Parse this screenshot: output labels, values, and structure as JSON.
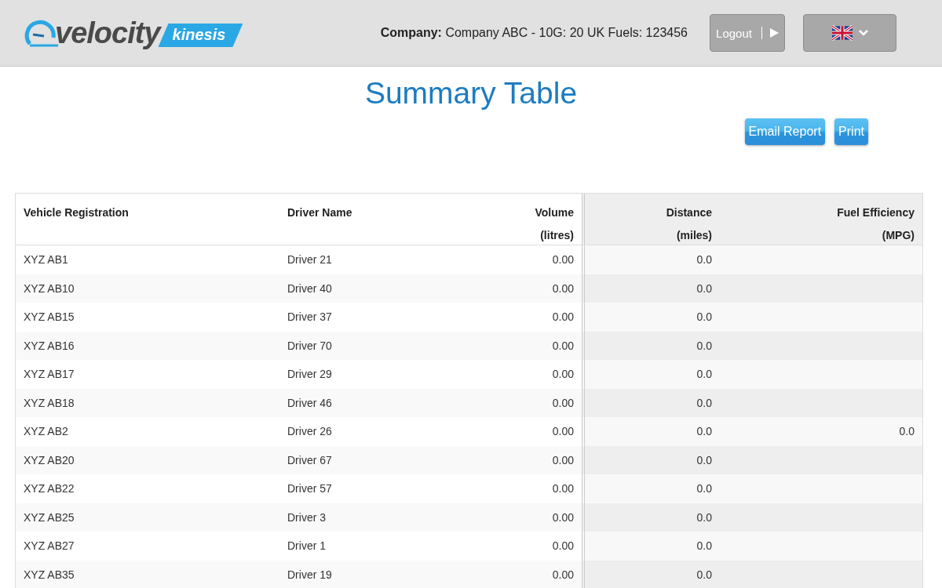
{
  "header": {
    "logo": {
      "word": "velocity",
      "badge": "kinesis"
    },
    "company": "**Company:** Company ABC - 10G: 20 UK Fuels: 123456",
    "logout": "Logout"
  },
  "title": "Summary Table",
  "actions": [
    "Email Report",
    "Print"
  ],
  "table": {
    "columns": [
      {
        "label": "Vehicle Registration",
        "kind": "text",
        "shaded": false
      },
      {
        "label": "Driver Name",
        "kind": "text",
        "shaded": false
      },
      {
        "label": "Volume",
        "unit": "(litres)",
        "kind": "number",
        "shaded": false
      },
      {
        "label": "Distance",
        "unit": "(miles)",
        "kind": "number",
        "shaded": true
      },
      {
        "label": "Fuel Efficiency",
        "unit": "(MPG)",
        "kind": "number",
        "shaded": true
      }
    ],
    "rows": [
      [
        "XYZ AB1",
        "Driver 21",
        "0.00",
        "0.0",
        null
      ],
      [
        "XYZ AB10",
        "Driver 40",
        "0.00",
        "0.0",
        null
      ],
      [
        "XYZ AB15",
        "Driver 37",
        "0.00",
        "0.0",
        null
      ],
      [
        "XYZ AB16",
        "Driver 70",
        "0.00",
        "0.0",
        null
      ],
      [
        "XYZ AB17",
        "Driver 29",
        "0.00",
        "0.0",
        null
      ],
      [
        "XYZ AB18",
        "Driver 46",
        "0.00",
        "0.0",
        null
      ],
      [
        "XYZ AB2",
        "Driver 26",
        "0.00",
        "0.0",
        "0.0"
      ],
      [
        "XYZ AB20",
        "Driver 67",
        "0.00",
        "0.0",
        null
      ],
      [
        "XYZ AB22",
        "Driver 57",
        "0.00",
        "0.0",
        null
      ],
      [
        "XYZ AB25",
        "Driver 3",
        "0.00",
        "0.0",
        null
      ],
      [
        "XYZ AB27",
        "Driver 1",
        "0.00",
        "0.0",
        null
      ],
      [
        "XYZ AB35",
        "Driver 19",
        "0.00",
        "0.0",
        null
      ]
    ]
  }
}
